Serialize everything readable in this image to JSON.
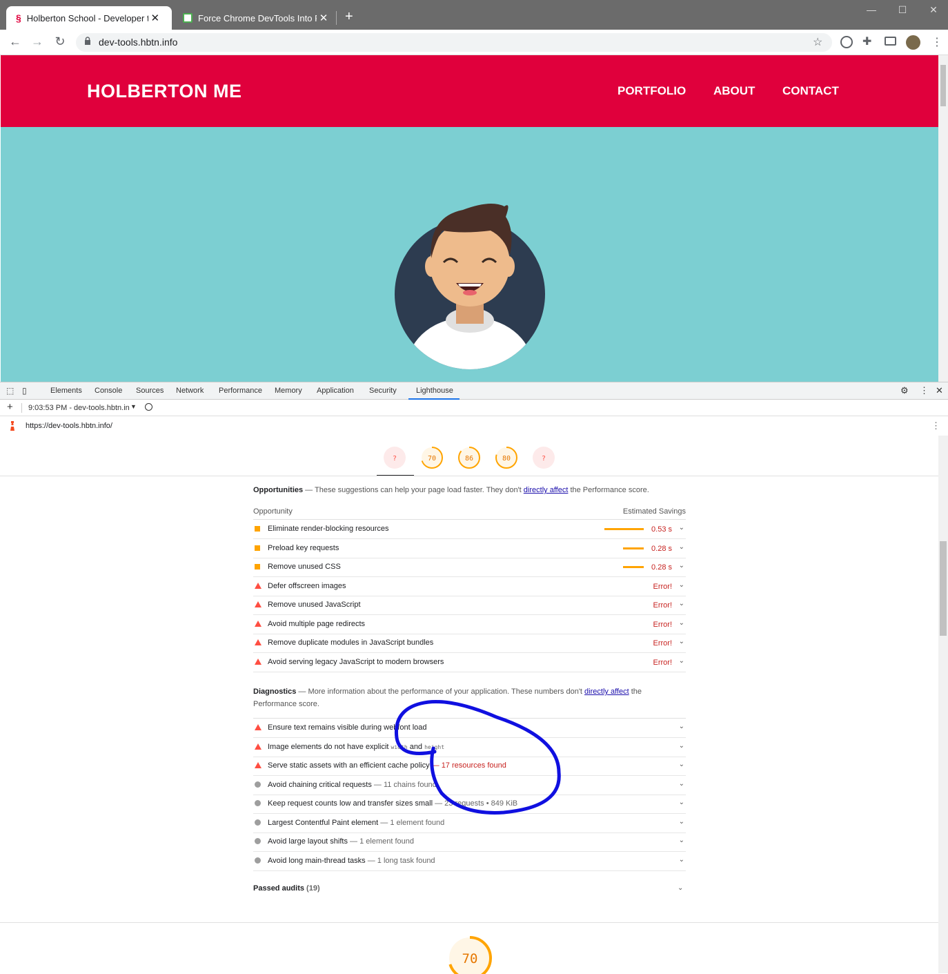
{
  "browser": {
    "tabs": [
      {
        "title": "Holberton School - Developer tools",
        "active": true
      },
      {
        "title": "Force Chrome DevTools Into Print",
        "active": false
      }
    ],
    "new_tab": "+",
    "url": "dev-tools.hbtn.info",
    "window_controls": {
      "minimize": "—",
      "maximize": "☐",
      "close": "✕"
    }
  },
  "site": {
    "title": "HOLBERTON ME",
    "nav": [
      "PORTFOLIO",
      "ABOUT",
      "CONTACT"
    ],
    "colors": {
      "header": "#e0003c",
      "hero": "#7ccfd2"
    }
  },
  "devtools": {
    "tabs": [
      "Elements",
      "Console",
      "Sources",
      "Network",
      "Performance",
      "Memory",
      "Application",
      "Security",
      "Lighthouse"
    ],
    "selected_tab": "Lighthouse",
    "report_selector": "9:03:53 PM - dev-tools.hbtn.in",
    "report_url": "https://dev-tools.hbtn.info/",
    "gauges": [
      {
        "label": "?",
        "status": "error"
      },
      {
        "label": "70",
        "status": "average"
      },
      {
        "label": "86",
        "status": "average"
      },
      {
        "label": "80",
        "status": "average"
      },
      {
        "label": "?",
        "status": "error"
      }
    ],
    "opportunities": {
      "title": "Opportunities",
      "desc_before": " — These suggestions can help your page load faster. They don't ",
      "link": "directly affect",
      "desc_after": " the Performance score.",
      "col_left": "Opportunity",
      "col_right": "Estimated Savings",
      "items": [
        {
          "label": "Eliminate render-blocking resources",
          "value": "0.53 s",
          "icon": "square",
          "bar": 0.53
        },
        {
          "label": "Preload key requests",
          "value": "0.28 s",
          "icon": "square",
          "bar": 0.28
        },
        {
          "label": "Remove unused CSS",
          "value": "0.28 s",
          "icon": "square",
          "bar": 0.28
        },
        {
          "label": "Defer offscreen images",
          "value": "Error!",
          "icon": "triangle"
        },
        {
          "label": "Remove unused JavaScript",
          "value": "Error!",
          "icon": "triangle"
        },
        {
          "label": "Avoid multiple page redirects",
          "value": "Error!",
          "icon": "triangle"
        },
        {
          "label": "Remove duplicate modules in JavaScript bundles",
          "value": "Error!",
          "icon": "triangle"
        },
        {
          "label": "Avoid serving legacy JavaScript to modern browsers",
          "value": "Error!",
          "icon": "triangle"
        }
      ]
    },
    "diagnostics": {
      "title": "Diagnostics",
      "desc_before": " — More information about the performance of your application. These numbers don't ",
      "link": "directly affect",
      "desc_after": " the",
      "desc_line2": "Performance score.",
      "items": [
        {
          "label": "Ensure text remains visible during webfont load",
          "detail": "",
          "icon": "triangle"
        },
        {
          "label": "Image elements do not have explicit ",
          "code1": "width",
          "mid": " and ",
          "code2": "height",
          "detail": "",
          "icon": "triangle"
        },
        {
          "label": "Serve static assets with an efficient cache policy",
          "detail": " — 17 resources found",
          "icon": "triangle",
          "detail_red": true
        },
        {
          "label": "Avoid chaining critical requests",
          "detail": " — 11 chains found",
          "icon": "dot"
        },
        {
          "label": "Keep request counts low and transfer sizes small",
          "detail": " — 23 requests • 849 KiB",
          "icon": "dot"
        },
        {
          "label": "Largest Contentful Paint element",
          "detail": " — 1 element found",
          "icon": "dot"
        },
        {
          "label": "Avoid large layout shifts",
          "detail": " — 1 element found",
          "icon": "dot"
        },
        {
          "label": "Avoid long main-thread tasks",
          "detail": " — 1 long task found",
          "icon": "dot"
        }
      ]
    },
    "passed": {
      "label": "Passed audits",
      "count": "(19)"
    },
    "bottom_gauge": "70",
    "colors": {
      "average": "#ffa400",
      "error": "#ff4e42",
      "annotation": "#1010e0"
    }
  }
}
